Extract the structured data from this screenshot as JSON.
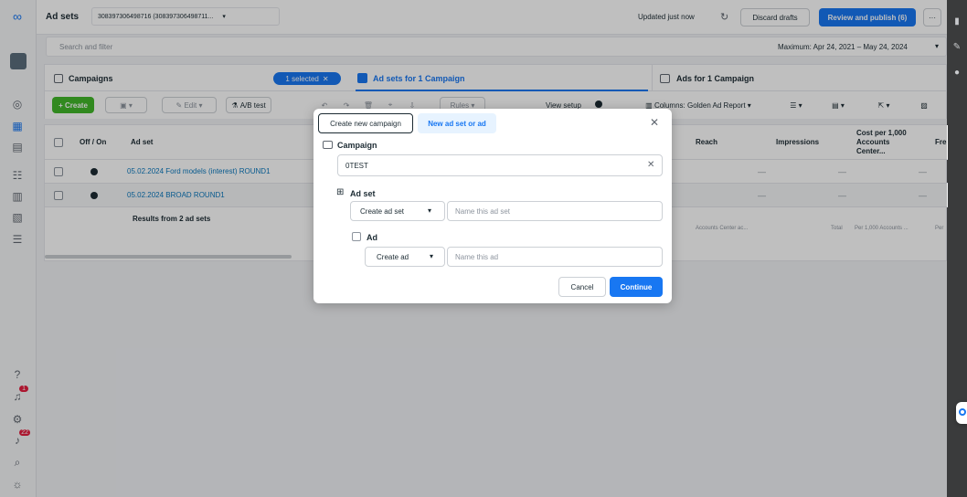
{
  "topbar": {
    "title": "Ad sets",
    "selector_value": "308397306498716 (308397306498711...",
    "updated": "Updated just now",
    "discard": "Discard drafts",
    "publish": "Review and publish (6)",
    "more": "···"
  },
  "search": {
    "placeholder": "Search and filter",
    "date_range": "Maximum: Apr 24, 2021 – May 24, 2024"
  },
  "tabs": {
    "campaigns": "Campaigns",
    "selected": "1 selected",
    "adsets": "Ad sets for 1 Campaign",
    "ads": "Ads for 1 Campaign"
  },
  "toolbar": {
    "create": "+ Create",
    "edit": "Edit",
    "abtest": "A/B test",
    "rules": "Rules",
    "view_setup": "View setup",
    "columns": "Columns: Golden Ad Report"
  },
  "table": {
    "headers": {
      "offon": "Off / On",
      "adset": "Ad set",
      "reach": "Reach",
      "impressions": "Impressions",
      "cost": "Cost per 1,000 Accounts Center...",
      "freq": "Fre"
    },
    "rows": [
      {
        "name": "05.02.2024 Ford models (interest) ROUND1",
        "reach": "—",
        "impressions": "—",
        "cost": "—"
      },
      {
        "name": "05.02.2024 BROAD ROUND1",
        "reach": "—",
        "impressions": "—",
        "cost": "—"
      }
    ],
    "results": "Results from 2 ad sets",
    "footer_reach": "Accounts Center ac...",
    "footer_total": "Total",
    "footer_cost": "Per 1,000 Accounts ...",
    "footer_freq": "Per"
  },
  "modal": {
    "tab_new_campaign": "Create new campaign",
    "tab_new_adset": "New ad set or ad",
    "campaign_label": "Campaign",
    "campaign_value": "0TEST",
    "adset_label": "Ad set",
    "adset_select": "Create ad set",
    "adset_placeholder": "Name this ad set",
    "ad_label": "Ad",
    "ad_select": "Create ad",
    "ad_placeholder": "Name this ad",
    "cancel": "Cancel",
    "continue": "Continue"
  },
  "rail": {
    "badge1": "1",
    "badge2": "22"
  },
  "colors": {
    "primary": "#1877f2",
    "publish": "#1877f2",
    "create": "#42b72a"
  }
}
